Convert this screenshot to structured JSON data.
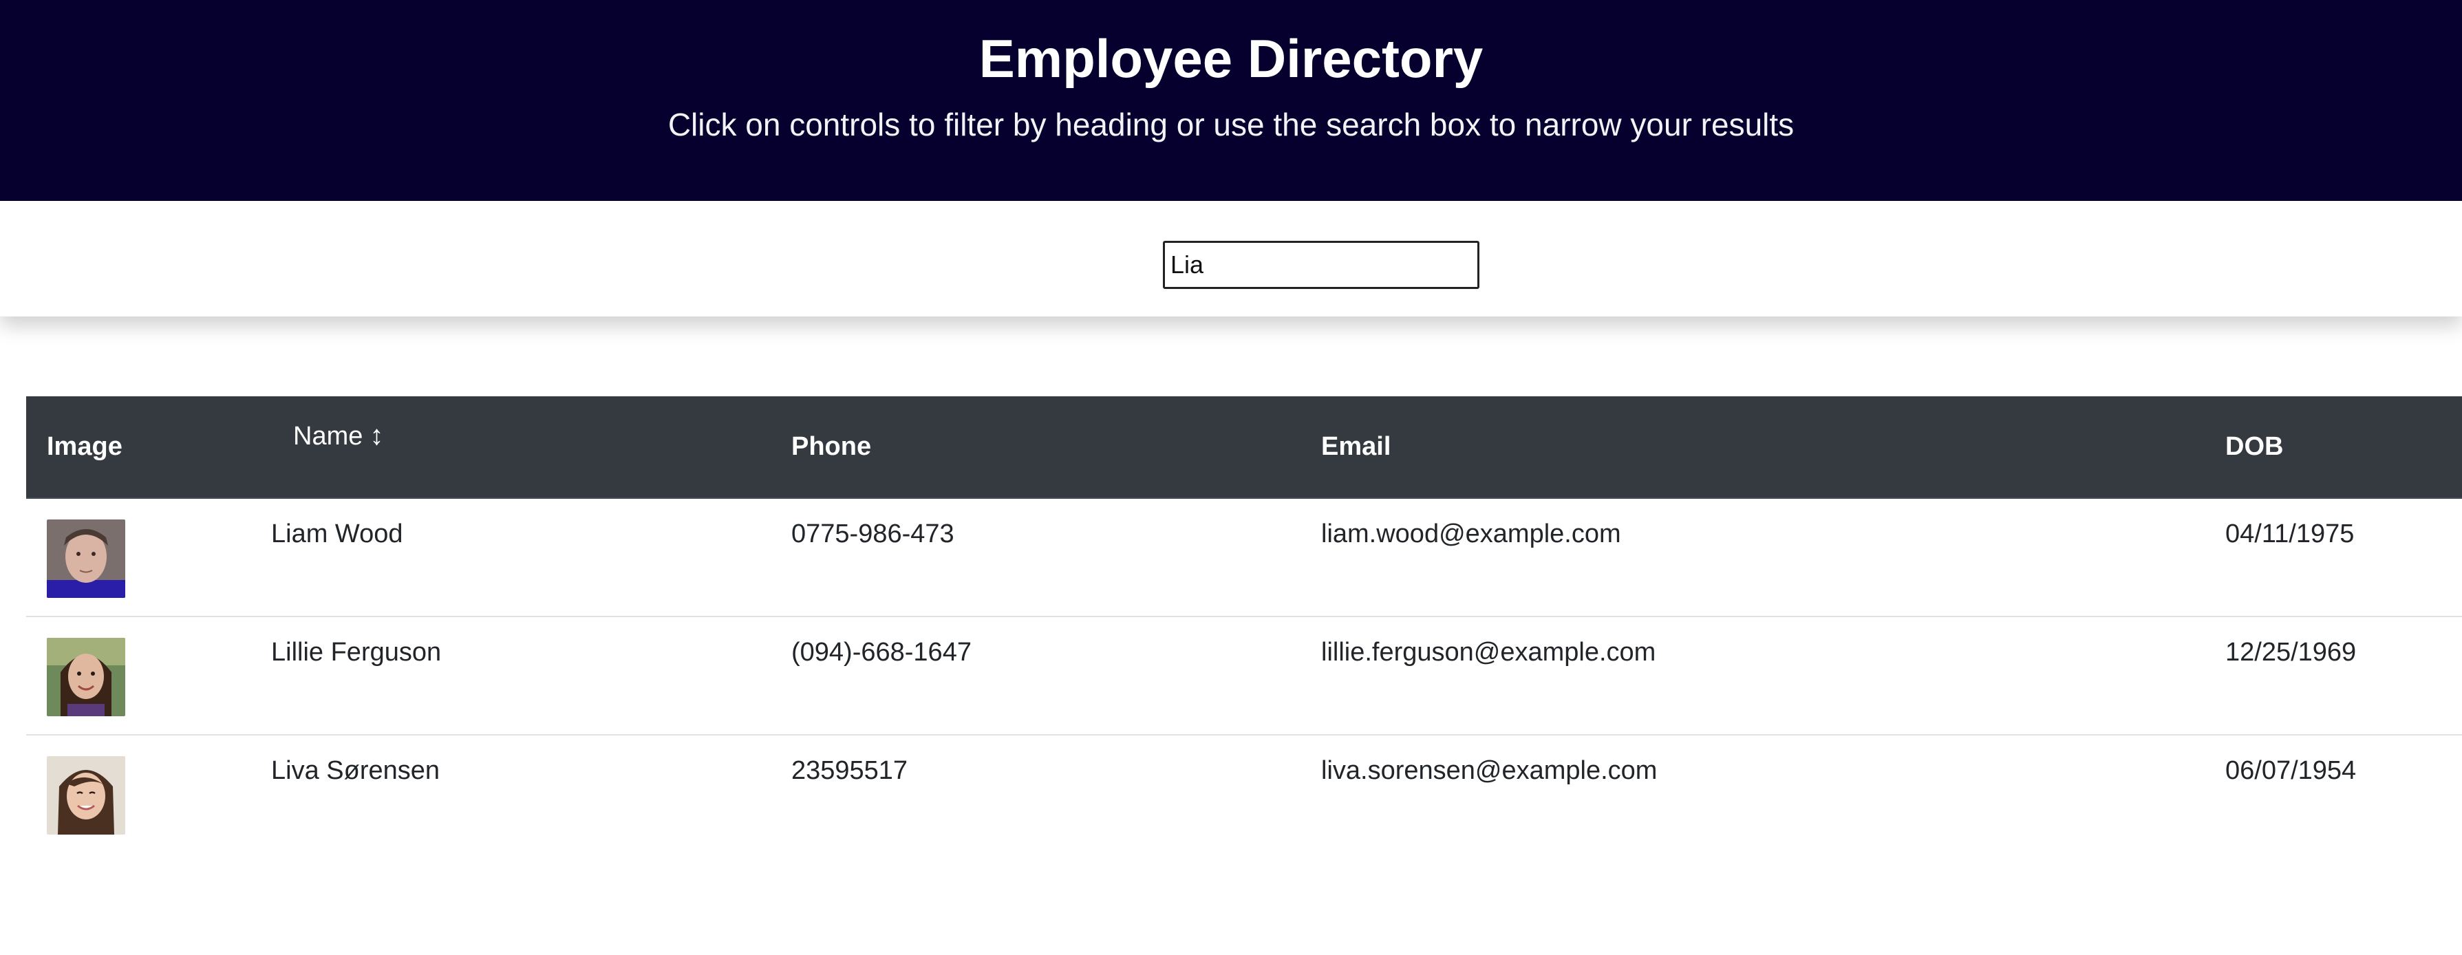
{
  "header": {
    "title": "Employee Directory",
    "subtitle": "Click on controls to filter by heading or use the search box to narrow your results"
  },
  "search": {
    "value": "Lia",
    "placeholder": ""
  },
  "table": {
    "columns": {
      "image": "Image",
      "name": "Name",
      "phone": "Phone",
      "email": "Email",
      "dob": "DOB"
    },
    "sort_icon": "↕",
    "rows": [
      {
        "name": "Liam Wood",
        "phone": "0775-986-473",
        "email": "liam.wood@example.com",
        "dob": "04/11/1975"
      },
      {
        "name": "Lillie Ferguson",
        "phone": "(094)-668-1647",
        "email": "lillie.ferguson@example.com",
        "dob": "12/25/1969"
      },
      {
        "name": "Liva Sørensen",
        "phone": "23595517",
        "email": "liva.sorensen@example.com",
        "dob": "06/07/1954"
      }
    ]
  },
  "colors": {
    "header_bg": "#06002f",
    "table_head_bg": "#343a40"
  }
}
